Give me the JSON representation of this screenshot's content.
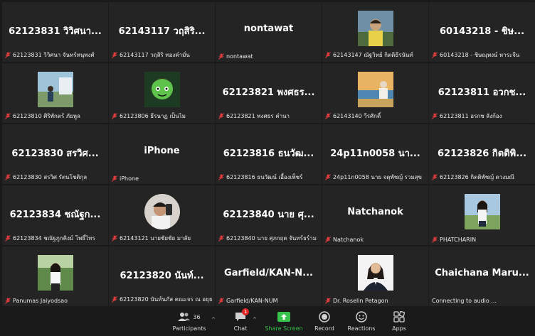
{
  "tiles": [
    {
      "big": "62123831 วิวิศนา...",
      "label": "62123831 วิวิศนา จันทร์หนุพงศ์"
    },
    {
      "big": "62143117 วฤสิริ...",
      "label": "62143117 วฤสิริ ทองคำมั่น"
    },
    {
      "big": "nontawat",
      "label": "nontawat"
    },
    {
      "photo": "photo-boy-outdoors",
      "label": "62143147 ณัฐวิทย์ กิตติธีรนันท์"
    },
    {
      "big": "60143218 - ชิษ...",
      "label": "60143218 - ชิษณุพงษ์ หาระจีน"
    },
    {
      "photo": "photo-person-outdoors",
      "label": "62123810 ศิริพักตร์ ภัยหูล"
    },
    {
      "photo": "photo-cartoon-avatar",
      "label": "62123806 ธีรนาฏ เป็นไม"
    },
    {
      "big": "62123821 พงศธร...",
      "label": "62123821 พงศธร คำนา"
    },
    {
      "photo": "photo-person-sunset",
      "label": "62143140 วีรศักดิ์"
    },
    {
      "big": "62123811 อวกช...",
      "label": "62123811 อรกช ลังก้อง"
    },
    {
      "big": "62123830 สรวิศ...",
      "label": "62123830 สรวิศ รัตนโชติกุล"
    },
    {
      "big": "iPhone",
      "label": "iPhone"
    },
    {
      "big": "62123816 ธนวัฒ...",
      "label": "62123816 ธนวัฒน์ เอื้องเพ็ชร์"
    },
    {
      "big": "24p11n0058 นา...",
      "label": "24p11n0058 นาย จตุพัชญ์ รวมสุข"
    },
    {
      "big": "62123826 กิตติพิ...",
      "label": "62123826 กิตติพัชญ์ ดวงมณี"
    },
    {
      "big": "62123834 ชณัฐก...",
      "label": "62123834 ชณัฐภูกคิงม์ โพธิ์ไทร"
    },
    {
      "photo": "photo-selfie-round",
      "round": true,
      "label": "62143121 นายชัยชัย มาลัย"
    },
    {
      "big": "62123840 นาย ศุ...",
      "label": "62123840 นาย ศุภกฤต จันทร์ธร์าม"
    },
    {
      "big": "Natchanok",
      "label": "Natchanok"
    },
    {
      "photo": "photo-woman-outdoors",
      "label": "PHATCHARIN"
    },
    {
      "photo": "photo-woman-garden",
      "label": "Panumas Jaiyodsao"
    },
    {
      "big": "62123820 นันท์...",
      "label": "62123820 นันท์นภัส คณะจร ณ อยุธยา"
    },
    {
      "big": "Garfield/KAN-N...",
      "label": "Garfield/KAN-NUM"
    },
    {
      "photo": "photo-woman-portrait",
      "label": "Dr. Roselin Petagon"
    },
    {
      "big": "Chaichana Maru...",
      "label": "Connecting to audio ...",
      "connecting": true
    }
  ],
  "toolbar": {
    "participants_label": "Participants",
    "participants_count": "36",
    "chat_label": "Chat",
    "chat_badge": "1",
    "share_label": "Share Screen",
    "record_label": "Record",
    "reactions_label": "Reactions",
    "apps_label": "Apps"
  },
  "colors": {
    "tile_bg": "#242424",
    "mute_red": "#e23c3c",
    "share_green": "#36c24b"
  }
}
